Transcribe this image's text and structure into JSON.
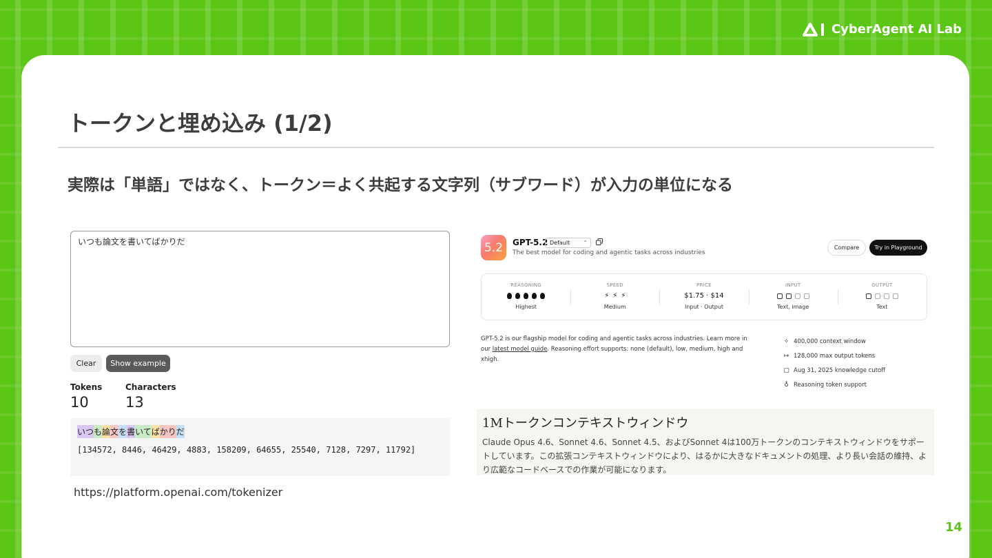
{
  "brand": {
    "name": "CyberAgent AI Lab"
  },
  "slide": {
    "title": "トークンと埋め込み (1/2)",
    "subtitle": "実際は「単語」ではなく、トークン＝よく共起する文字列（サブワード）が入力の単位になる",
    "page_number": "14"
  },
  "tokenizer": {
    "input_text": "いつも論文を書いてばかりだ",
    "clear_label": "Clear",
    "example_label": "Show example",
    "tokens_label": "Tokens",
    "tokens_value": "10",
    "characters_label": "Characters",
    "characters_value": "13",
    "segments": [
      {
        "text": "いつ",
        "color": "#d9c6f2"
      },
      {
        "text": "も",
        "color": "#c9ecc8"
      },
      {
        "text": "論",
        "color": "#f9e3a8"
      },
      {
        "text": "文",
        "color": "#f6c7c1"
      },
      {
        "text": "を",
        "color": "#c6e0f6"
      },
      {
        "text": "書",
        "color": "#d9c6f2"
      },
      {
        "text": "いて",
        "color": "#c9ecc8"
      },
      {
        "text": "ば",
        "color": "#f9e3a8"
      },
      {
        "text": "かり",
        "color": "#f6c7c1"
      },
      {
        "text": "だ",
        "color": "#c6e0f6"
      }
    ],
    "token_ids": "[134572, 8446, 46429, 4883, 158209, 64655, 25540, 7128, 7297, 11792]",
    "source_url": "https://platform.openai.com/tokenizer"
  },
  "gpt": {
    "icon_text": "5.2",
    "name": "GPT-5.2",
    "select_value": "Default",
    "description": "The best model for coding and agentic tasks across industries",
    "compare_label": "Compare",
    "try_label": "Try in Playground",
    "metrics": {
      "reasoning": {
        "label": "REASONING",
        "sub": "Highest",
        "level": 5,
        "max": 5
      },
      "speed": {
        "label": "SPEED",
        "sub": "Medium",
        "level": 3,
        "max": 3
      },
      "price": {
        "label": "PRICE",
        "main": "$1.75 · $14",
        "sub": "Input · Output"
      },
      "input": {
        "label": "INPUT",
        "sub": "Text, image"
      },
      "output": {
        "label": "OUTPUT",
        "sub": "Text"
      }
    },
    "body_part1": "GPT-5.2 is our flagship model for coding and agentic tasks across industries. Learn more in our",
    "body_link": "latest model guide",
    "body_part2": ". Reasoning.effort supports: none (default), low, medium, high and xhigh.",
    "features": [
      {
        "icon": "sparkle-icon",
        "text": "400,000 context window"
      },
      {
        "icon": "arrow-out-icon",
        "text": "128,000 max output tokens"
      },
      {
        "icon": "calendar-icon",
        "text": "Aug 31, 2025 knowledge cutoff"
      },
      {
        "icon": "bulb-icon",
        "text": "Reasoning token support"
      }
    ]
  },
  "claude": {
    "title": "1Mトークンコンテキストウィンドウ",
    "body": "Claude Opus 4.6、Sonnet 4.6、Sonnet 4.5、およびSonnet 4は100万トークンのコンテキストウィンドウをサポートしています。この拡張コンテキストウィンドウにより、はるかに大きなドキュメントの処理、より長い会話の維持、より広範なコードベースでの作業が可能になります。"
  }
}
